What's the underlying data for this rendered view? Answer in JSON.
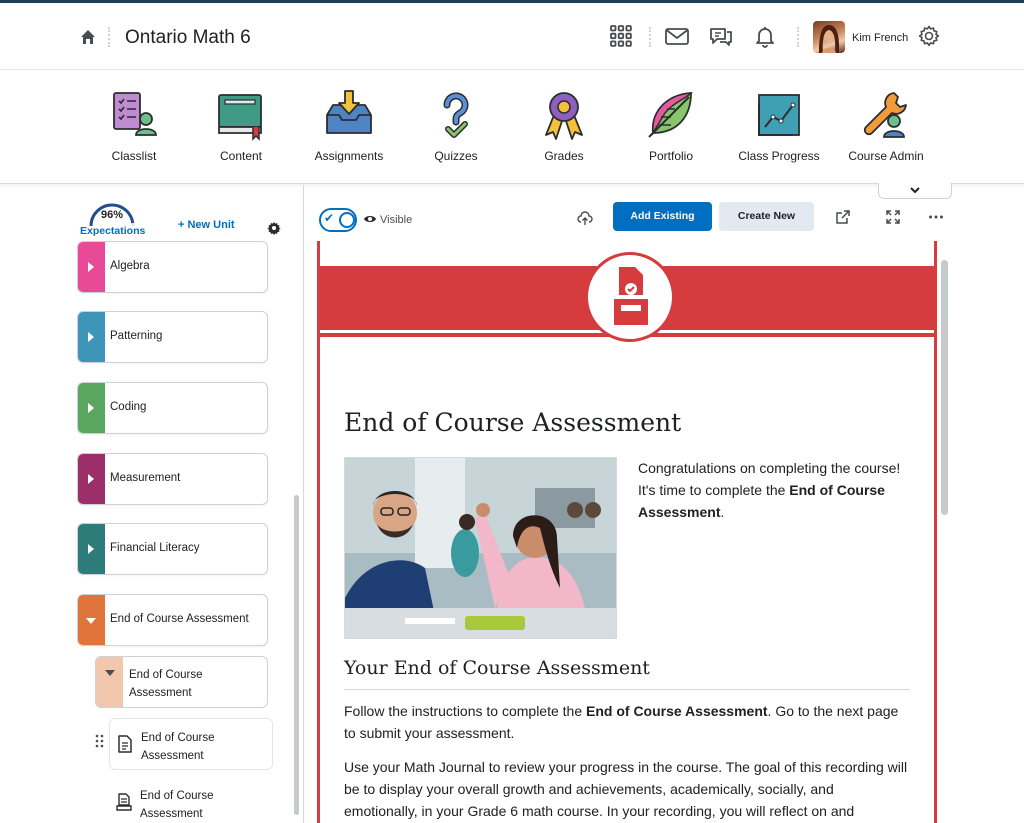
{
  "header": {
    "course_title": "Ontario Math 6",
    "user_name": "Kim French"
  },
  "nav": {
    "items": [
      {
        "label": "Classlist",
        "icon": "classlist-icon"
      },
      {
        "label": "Content",
        "icon": "content-book-icon"
      },
      {
        "label": "Assignments",
        "icon": "assignments-inbox-icon"
      },
      {
        "label": "Quizzes",
        "icon": "quizzes-question-icon"
      },
      {
        "label": "Grades",
        "icon": "grades-ribbon-icon"
      },
      {
        "label": "Portfolio",
        "icon": "portfolio-leaf-icon"
      },
      {
        "label": "Class Progress",
        "icon": "class-progress-chart-icon"
      },
      {
        "label": "Course Admin",
        "icon": "course-admin-tools-icon"
      }
    ]
  },
  "sidebar": {
    "expectations_value": "96%",
    "expectations_label": "Expectations",
    "expectations_fraction": 0.96,
    "new_unit_label": "+ New Unit",
    "units": [
      {
        "label": "Algebra",
        "color": "#e84a97"
      },
      {
        "label": "Patterning",
        "color": "#3d95b8"
      },
      {
        "label": "Coding",
        "color": "#5aa65e"
      },
      {
        "label": "Measurement",
        "color": "#9a2f6a"
      },
      {
        "label": "Financial Literacy",
        "color": "#2e7c7a"
      },
      {
        "label": "End of Course Assessment",
        "color": "#e0753c"
      }
    ],
    "subunit_label": "End of Course Assessment",
    "topics": [
      {
        "label": "End of Course Assessment"
      },
      {
        "label": "End of Course Assessment"
      }
    ]
  },
  "toolbar": {
    "visibility_label": "Visible",
    "add_existing_label": "Add Existing",
    "create_new_label": "Create New"
  },
  "content": {
    "title": "End of Course Assessment",
    "intro_1": "Congratulations on completing the course! It's time to complete the ",
    "intro_bold": "End of Course Assessment",
    "intro_2": ".",
    "section_title": "Your End of Course Assessment",
    "p1_a": "Follow the instructions to complete the ",
    "p1_bold": "End of Course Assessment",
    "p1_b": ". Go to the next page to submit your assessment.",
    "p2": "Use your Math Journal to review your progress in the course. The goal of this recording will be to display your overall growth and achievements, academically, socially, and emotionally, in your Grade 6 math course. In your recording, you will reflect on and",
    "accent_color": "#d63b3e"
  }
}
